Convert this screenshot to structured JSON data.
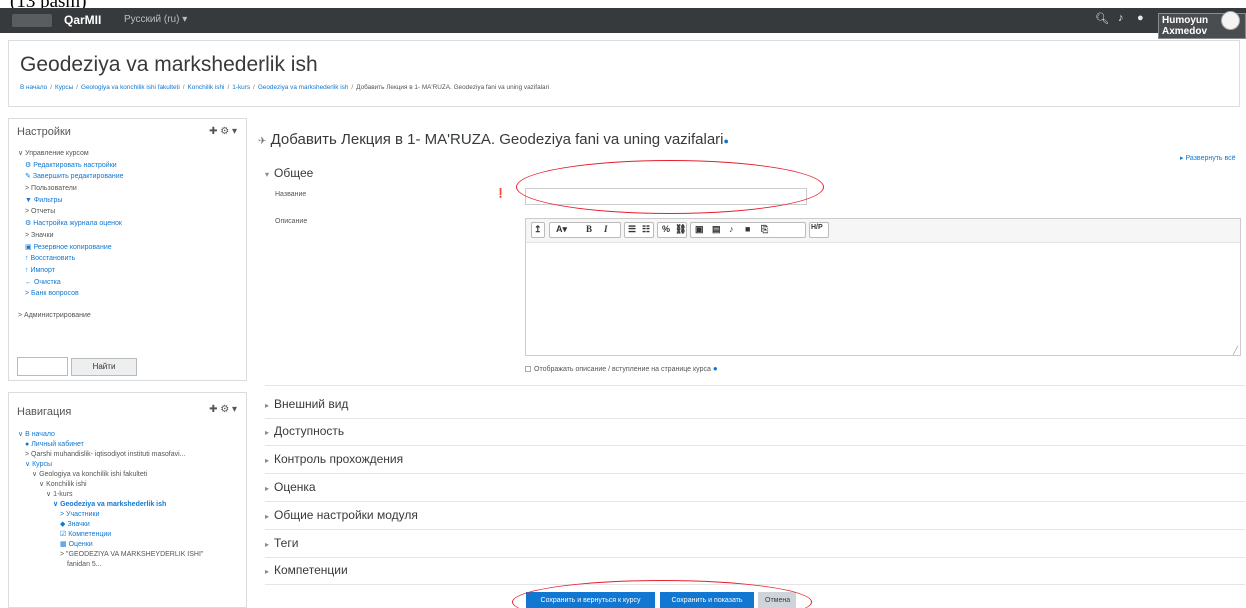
{
  "caption_top": "(13   pasm)",
  "topbar": {
    "site_name": "QarMII",
    "language": "Русский (ru) ▾",
    "search_icon": "search-icon",
    "bell_icon": "bell-icon",
    "chat_icon": "chat-icon",
    "user_name": "Humoyun Axmedov"
  },
  "page": {
    "course_title": "Geodeziya va markshederlik ish",
    "breadcrumb": [
      "В начало",
      "Курсы",
      "Geologiya va konchilik ishi fakulteti",
      "Konchilik ishi",
      "1-kurs",
      "Geodeziya va markshederlik ish",
      "Добавить Лекция в 1- MA'RUZA. Geodeziya fani va uning vazifalari"
    ]
  },
  "settings_block": {
    "title": "Настройки",
    "items": [
      "Управление курсом",
      "Редактировать настройки",
      "Завершить редактирование",
      "Пользователи",
      "Фильтры",
      "Отчеты",
      "Настройка журнала оценок",
      "Значки",
      "Резервное копирование",
      "Восстановить",
      "Импорт",
      "Очистка",
      "Банк вопросов"
    ],
    "admin_label": "Администрирование",
    "search_button": "Найти"
  },
  "nav_block": {
    "title": "Навигация",
    "items": [
      "В начало",
      "Личный кабинет",
      "Qarshi muhandislik- iqtisodiyot instituti masofavi...",
      "Курсы",
      "Geologiya va konchilik ishi fakulteti",
      "Konchilik ishi",
      "1-kurs",
      "Geodeziya va markshederlik ish",
      "Участники",
      "Значки",
      "Компетенции",
      "Оценки",
      "\"GEODEZIYA VA MARKSHEYDERLIK ISHI\"",
      "fanidan 5..."
    ]
  },
  "form": {
    "title": "Добавить Лекция в 1- MA'RUZA. Geodeziya fani va uning vazifalari",
    "expand_all": "Развернуть всё",
    "section_general": "Общее",
    "name_label": "Название",
    "description_label": "Описание",
    "name_value": "",
    "description_value": "",
    "show_description_label": "Отображать описание / вступление на странице курса",
    "sections": [
      "Внешний вид",
      "Доступность",
      "Контроль прохождения",
      "Оценка",
      "Общие настройки модуля",
      "Теги",
      "Компетенции"
    ],
    "buttons": {
      "save_return": "Сохранить и вернуться к курсу",
      "save_display": "Сохранить и показать",
      "cancel": "Отмена"
    },
    "editor_toolbar": [
      "↥",
      "A▾",
      "B",
      "I",
      "☰",
      "☷",
      "%",
      "⛓",
      "▣",
      "▤",
      "♪",
      "■",
      "⎘",
      "H/P"
    ]
  },
  "colors": {
    "accent": "#1177d1",
    "topbar_bg": "#373a3c",
    "annotation": "#e5202e"
  }
}
